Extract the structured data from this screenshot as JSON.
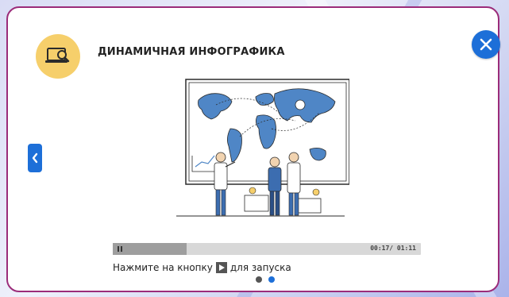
{
  "header": {
    "title": "ДИНАМИЧНАЯ ИНФОГРАФИКА",
    "topic_icon": "laptop-search-icon",
    "close_icon": "close-icon"
  },
  "navigation": {
    "prev_icon": "chevron-left-icon"
  },
  "player": {
    "time": "00:17/ 01:11",
    "progress": 0.24,
    "pause_icon": "pause-icon"
  },
  "hint": {
    "before": "Нажмите на кнопку",
    "after": "для запуска",
    "play_icon": "play-icon"
  },
  "pagination": {
    "pages": 2,
    "active": 2
  },
  "colors": {
    "accent": "#1d6fd8",
    "border": "#9b2c7a",
    "icon_bg": "#f6cf6b",
    "map": "#4f86c6"
  }
}
